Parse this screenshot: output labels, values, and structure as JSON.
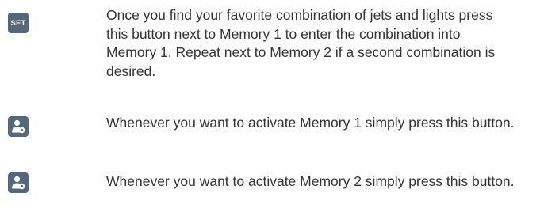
{
  "items": [
    {
      "icon": "set-button-icon",
      "icon_label": "SET",
      "text": "Once you find your favorite combination of jets and lights press this button next to Memory 1 to enter the combination into Memory 1. Repeat next to Memory 2 if a second combination is desired."
    },
    {
      "icon": "memory-user-icon",
      "text": "Whenever you want to activate Memory 1 simply press this button."
    },
    {
      "icon": "memory-user-icon",
      "text": "Whenever you want to activate Memory 2 simply press this button."
    }
  ],
  "colors": {
    "icon_background": "#55677b",
    "icon_foreground": "#ffffff",
    "text": "#333333"
  }
}
